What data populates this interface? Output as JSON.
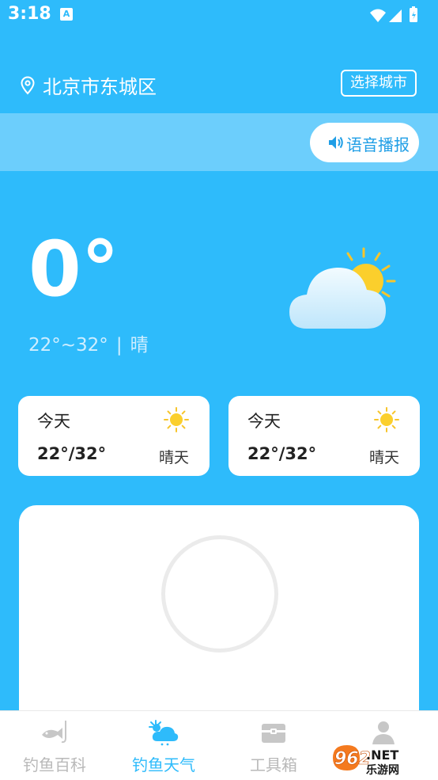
{
  "status_bar": {
    "time": "3:18",
    "notification_icon": "A"
  },
  "header": {
    "location": "北京市东城区",
    "select_city_label": "选择城市",
    "voice_label": "语音播报"
  },
  "current": {
    "temperature": "0°",
    "range": "22°~32°",
    "separator": "|",
    "condition": "晴",
    "icon": "partly-cloudy-icon"
  },
  "forecast": [
    {
      "day": "今天",
      "temps": "22°/32°",
      "condition": "晴天",
      "icon": "sun-icon"
    },
    {
      "day": "今天",
      "temps": "22°/32°",
      "condition": "晴天",
      "icon": "sun-icon"
    }
  ],
  "tabs": [
    {
      "label": "钓鱼百科",
      "icon": "fish-hook-icon",
      "active": false
    },
    {
      "label": "钓鱼天气",
      "icon": "weather-icon",
      "active": true
    },
    {
      "label": "工具箱",
      "icon": "toolbox-icon",
      "active": false
    },
    {
      "label": "",
      "icon": "person-icon",
      "active": false
    }
  ],
  "watermark": {
    "brand": "962.NET",
    "caption": "乐游网"
  },
  "colors": {
    "primary": "#2ebbfb",
    "strip": "#6ccefc",
    "inactive_tab": "#b9b9b9"
  }
}
